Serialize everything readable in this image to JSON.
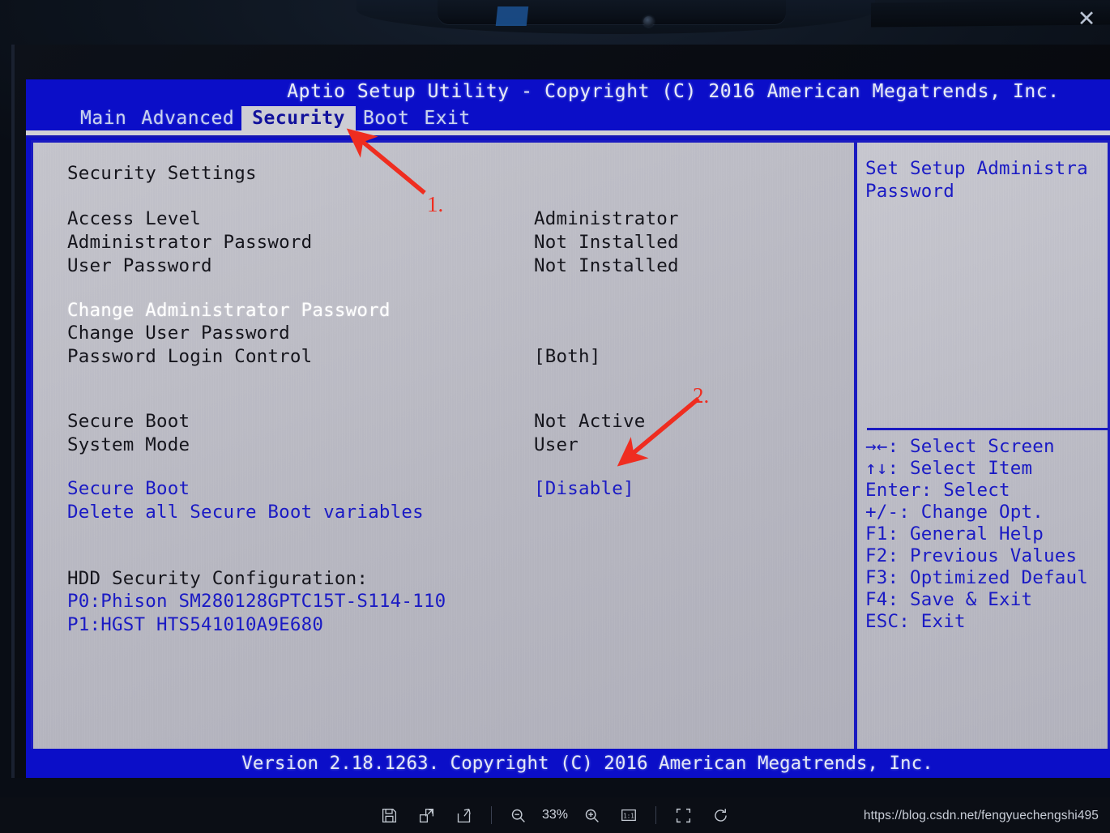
{
  "viewer": {
    "close_label": "✕",
    "zoom_level": "33%",
    "watermark": "https://blog.csdn.net/fengyuechengshi495",
    "toolbar": [
      {
        "name": "save-icon",
        "title": "Save"
      },
      {
        "name": "resize-icon",
        "title": "Resize"
      },
      {
        "name": "share-icon",
        "title": "Share"
      },
      {
        "name": "zoom-out-icon",
        "title": "Zoom out"
      },
      {
        "name": "zoom-in-icon",
        "title": "Zoom in"
      },
      {
        "name": "actual-size-icon",
        "title": "1:1"
      },
      {
        "name": "fit-screen-icon",
        "title": "Fit to screen"
      },
      {
        "name": "rotate-icon",
        "title": "Rotate"
      }
    ]
  },
  "bios": {
    "title": "Aptio Setup Utility - Copyright (C) 2016 American Megatrends, Inc.",
    "version_bar": "Version 2.18.1263. Copyright (C) 2016 American Megatrends, Inc.",
    "tabs": [
      {
        "label": "Main",
        "active": false
      },
      {
        "label": "Advanced",
        "active": false
      },
      {
        "label": "Security",
        "active": true
      },
      {
        "label": "Boot",
        "active": false
      },
      {
        "label": "Exit",
        "active": false
      }
    ],
    "section_heading": "Security Settings",
    "items": [
      {
        "label": "Access Level",
        "value": "Administrator",
        "style": "dark"
      },
      {
        "label": "Administrator Password",
        "value": "Not Installed",
        "style": "dark"
      },
      {
        "label": "User Password",
        "value": "Not Installed",
        "style": "dark"
      },
      {
        "label": "Change Administrator Password",
        "value": "",
        "style": "white"
      },
      {
        "label": "Change User Password",
        "value": "",
        "style": "dark"
      },
      {
        "label": "Password Login Control",
        "value": "[Both]",
        "style": "dark"
      },
      {
        "label": "Secure Boot",
        "value": "Not Active",
        "style": "dark"
      },
      {
        "label": "System Mode",
        "value": "User",
        "style": "dark"
      },
      {
        "label": "Secure Boot",
        "value": "[Disable]",
        "style": "blue"
      },
      {
        "label": "Delete all Secure Boot variables",
        "value": "",
        "style": "blue"
      },
      {
        "label": "HDD Security Configuration:",
        "value": "",
        "style": "dark"
      },
      {
        "label": "P0:Phison SM280128GPTC15T-S114-110",
        "value": "",
        "style": "blue"
      },
      {
        "label": "P1:HGST HTS541010A9E680",
        "value": "",
        "style": "blue"
      }
    ],
    "help": {
      "line1": "Set Setup Administra",
      "line2": "Password"
    },
    "keys": [
      {
        "key": "→←:",
        "action": "Select Screen"
      },
      {
        "key": "↑↓:",
        "action": "Select Item"
      },
      {
        "key": "Enter:",
        "action": "Select"
      },
      {
        "key": "+/-:",
        "action": "Change Opt."
      },
      {
        "key": "F1:",
        "action": "General Help"
      },
      {
        "key": "F2:",
        "action": "Previous Values"
      },
      {
        "key": "F3:",
        "action": "Optimized Defaul"
      },
      {
        "key": "F4:",
        "action": "Save & Exit"
      },
      {
        "key": "ESC:",
        "action": "Exit"
      }
    ]
  },
  "annotations": [
    {
      "label": "1.",
      "target": "security-tab"
    },
    {
      "label": "2.",
      "target": "secure-boot-value"
    }
  ],
  "colors": {
    "bios_blue": "#0b0ec8",
    "panel_gray": "#b9b9c2",
    "text_blue": "#1a1ac4",
    "annotation_red": "#ef2d20"
  }
}
